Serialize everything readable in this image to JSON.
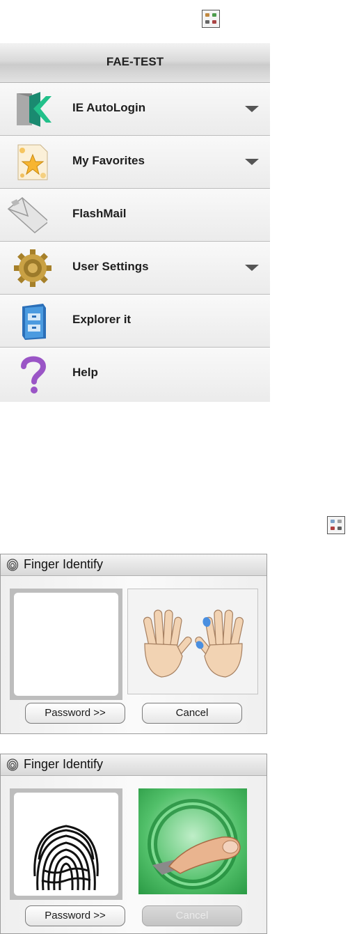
{
  "menu": {
    "title": "FAE-TEST",
    "items": [
      {
        "label": "IE AutoLogin",
        "icon": "ie-autologin-icon",
        "has_dropdown": true
      },
      {
        "label": "My Favorites",
        "icon": "favorites-star-icon",
        "has_dropdown": true
      },
      {
        "label": "FlashMail",
        "icon": "flashmail-envelope-icon",
        "has_dropdown": false
      },
      {
        "label": "User Settings",
        "icon": "settings-gear-icon",
        "has_dropdown": true
      },
      {
        "label": "Explorer it",
        "icon": "explorer-cabinet-icon",
        "has_dropdown": false
      },
      {
        "label": "Help",
        "icon": "help-question-icon",
        "has_dropdown": false
      }
    ]
  },
  "dialog1": {
    "title": "Finger Identify",
    "password_label": "Password >>",
    "cancel_label": "Cancel",
    "cancel_enabled": true
  },
  "dialog2": {
    "title": "Finger Identify",
    "password_label": "Password >>",
    "cancel_label": "Cancel",
    "cancel_enabled": false
  },
  "colors": {
    "menu_background": "#f6f6f6",
    "finger_highlight": "#4a8fe0",
    "scan_green": "#2fae4a",
    "disabled_button": "#c8c8c8"
  }
}
